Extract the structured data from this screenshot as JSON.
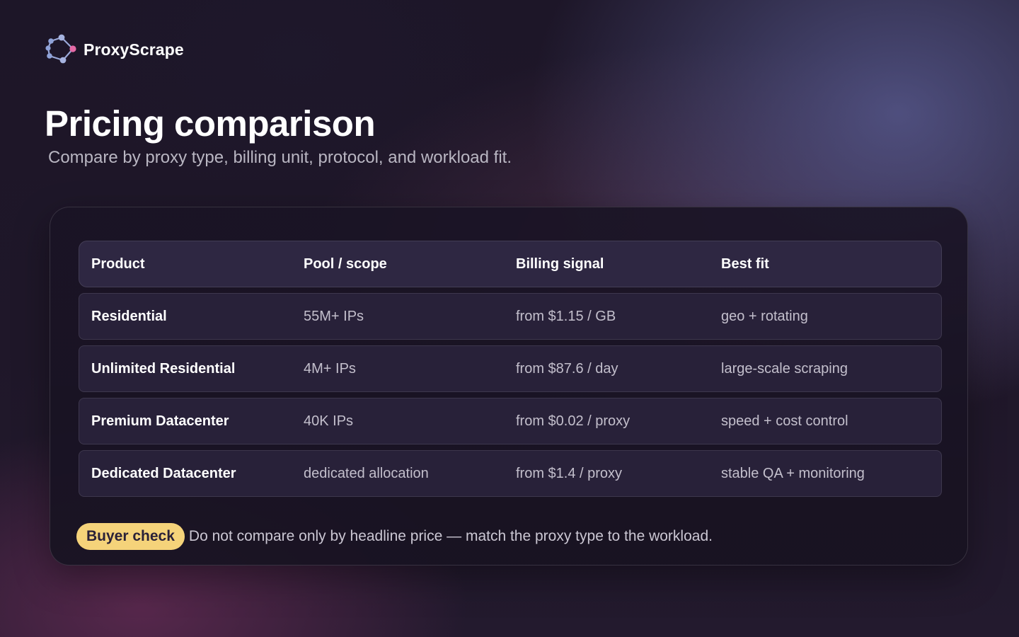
{
  "brand": {
    "name": "ProxyScrape",
    "logo_icon": "network-nodes-icon",
    "colors": {
      "nodes": "#8fa2d8",
      "accent_node": "#e46aa6"
    }
  },
  "header": {
    "title": "Pricing comparison",
    "subtitle": "Compare by proxy type, billing unit, protocol, and workload fit."
  },
  "table": {
    "columns": [
      "Product",
      "Pool / scope",
      "Billing signal",
      "Best fit"
    ],
    "rows": [
      {
        "product": "Residential",
        "pool": "55M+ IPs",
        "billing": "from $1.15 / GB",
        "fit": "geo + rotating"
      },
      {
        "product": "Unlimited Residential",
        "pool": "4M+ IPs",
        "billing": "from $87.6 / day",
        "fit": "large-scale scraping"
      },
      {
        "product": "Premium Datacenter",
        "pool": "40K IPs",
        "billing": "from $0.02 / proxy",
        "fit": "speed + cost control"
      },
      {
        "product": "Dedicated Datacenter",
        "pool": "dedicated allocation",
        "billing": "from $1.4 / proxy",
        "fit": "stable QA + monitoring"
      }
    ]
  },
  "note": {
    "badge": "Buyer check",
    "text": "Do not compare only by headline price — match the proxy type to the workload.",
    "badge_color": "#f5d37a"
  }
}
